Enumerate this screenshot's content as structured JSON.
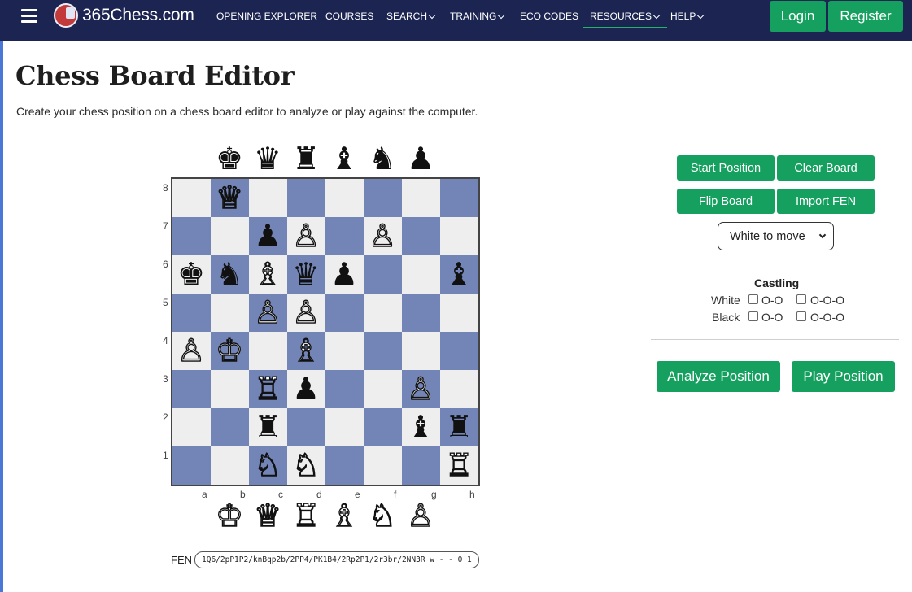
{
  "nav": {
    "brand": "365Chess.com",
    "items": [
      {
        "label": "OPENING EXPLORER",
        "dropdown": false
      },
      {
        "label": "COURSES",
        "dropdown": false
      },
      {
        "label": "SEARCH",
        "dropdown": true
      },
      {
        "label": "TRAINING",
        "dropdown": true
      },
      {
        "label": "ECO CODES",
        "dropdown": false
      },
      {
        "label": "RESOURCES",
        "dropdown": true,
        "active": true
      },
      {
        "label": "HELP",
        "dropdown": true
      }
    ],
    "login": "Login",
    "register": "Register"
  },
  "page": {
    "title": "Chess Board Editor",
    "intro": "Create your chess position on a chess board editor to analyze or play against the computer."
  },
  "board": {
    "light_color": "#eeeeee",
    "dark_color": "#7385b7",
    "ranks": [
      "8",
      "7",
      "6",
      "5",
      "4",
      "3",
      "2",
      "1"
    ],
    "files": [
      "a",
      "b",
      "c",
      "d",
      "e",
      "f",
      "g",
      "h"
    ],
    "black_palette": [
      "♚",
      "♛",
      "♜",
      "♝",
      "♞",
      "♟"
    ],
    "white_palette": [
      "♔",
      "♕",
      "♖",
      "♗",
      "♘",
      "♙"
    ],
    "fen_label": "FEN",
    "fen": "1Q6/2pP1P2/knBqp2b/2PP4/PK1B4/2Rp2P1/2r3br/2NN3R w - - 0 1"
  },
  "controls": {
    "start_position": "Start Position",
    "clear_board": "Clear Board",
    "flip_board": "Flip Board",
    "import_fen": "Import FEN",
    "side_to_move": "White to move",
    "castling_title": "Castling",
    "white_label": "White",
    "black_label": "Black",
    "short_castle": "O-O",
    "long_castle": "O-O-O",
    "analyze": "Analyze Position",
    "play": "Play Position"
  }
}
